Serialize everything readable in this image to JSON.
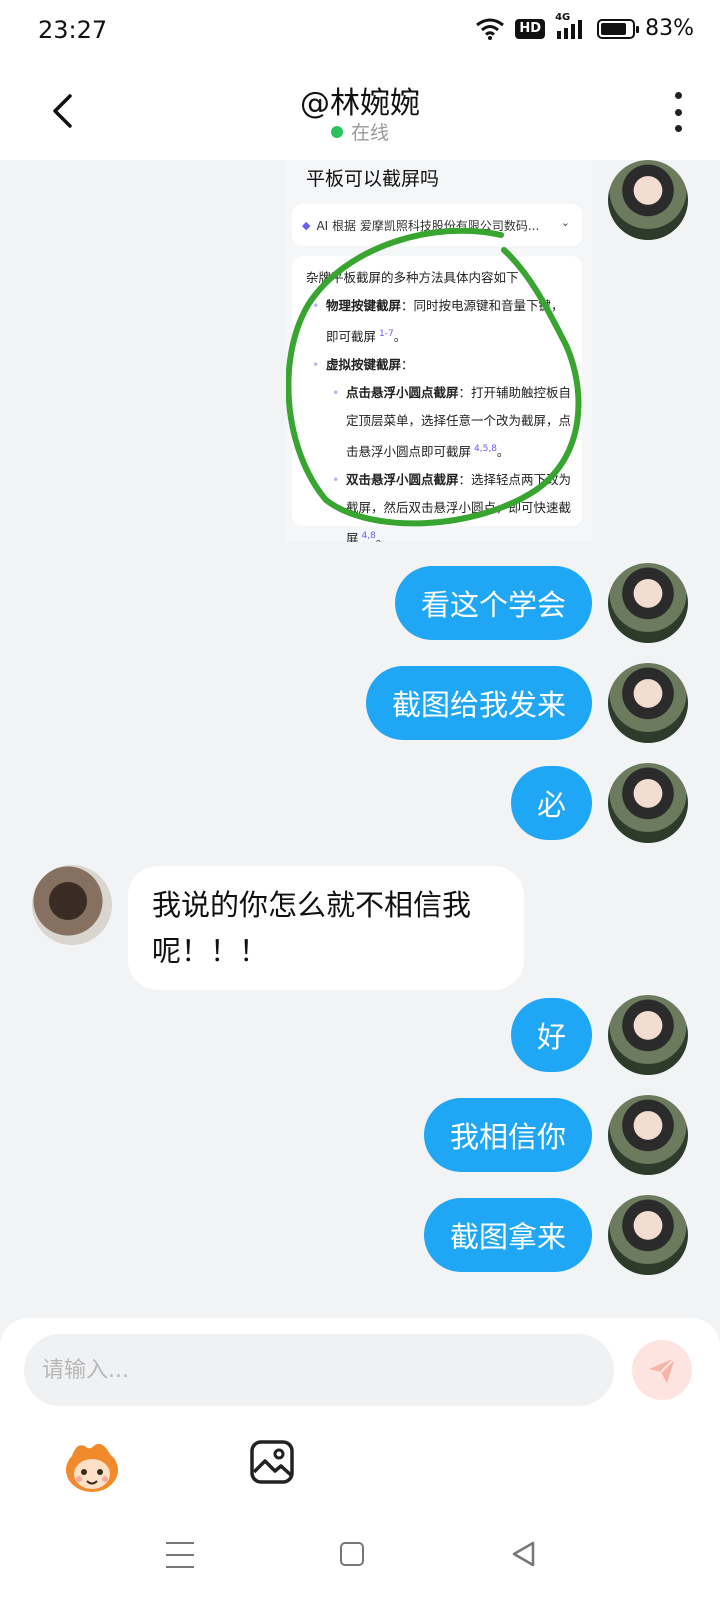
{
  "status_bar": {
    "time": "23:27",
    "network": "4G",
    "hd": "HD",
    "battery": "83%",
    "battery_level": 0.83
  },
  "header": {
    "title": "@林婉婉",
    "status": "在线"
  },
  "screenshot_card": {
    "title": "平板可以截屏吗",
    "ai_line": "AI 根据 爱摩凯照科技股份有限公司数码...",
    "intro": "杂牌平板截屏的多种方法具体内容如下",
    "b1_head": "物理按键截屏",
    "b1_text": "：同时按电源键和音量下键，",
    "b1_text2": "即可截屏",
    "b1_ref": "1-7",
    "b2_head": "虚拟按键截屏",
    "b2_text": "：",
    "s1_head": "点击悬浮小圆点截屏",
    "s1_text": "：打开辅助触控板自",
    "s1_text2": "定顶层菜单，选择任意一个改为截屏，点",
    "s1_text3": "击悬浮小圆点即可截屏",
    "s1_ref": "4,5,8",
    "s2_head": "双击悬浮小圆点截屏",
    "s2_text": "：选择轻点两下改为",
    "s2_text2": "截屏，然后双击悬浮小圆点，即可快速截",
    "s2_text3": "屏",
    "s2_ref": "4,8",
    "period": "。"
  },
  "messages": [
    {
      "from": "me",
      "text": "看这个学会"
    },
    {
      "from": "me",
      "text": "截图给我发来"
    },
    {
      "from": "me",
      "text": "必"
    },
    {
      "from": "other",
      "text": "我说的你怎么就不相信我呢！！！"
    },
    {
      "from": "me",
      "text": "好"
    },
    {
      "from": "me",
      "text": "我相信你"
    },
    {
      "from": "me",
      "text": "截图拿来"
    }
  ],
  "input": {
    "placeholder": "请输入..."
  },
  "colors": {
    "outgoing_bubble": "#1fa6f5",
    "online_dot": "#2bc35b",
    "send_button_bg": "#fde4e1",
    "send_icon": "#f6b3a8"
  },
  "icons": [
    "wifi-icon",
    "signal-icon",
    "battery-icon",
    "back-arrow-icon",
    "more-vertical-icon",
    "send-icon",
    "mascot-icon",
    "image-icon",
    "nav-menu-icon",
    "nav-home-icon",
    "nav-back-icon"
  ]
}
